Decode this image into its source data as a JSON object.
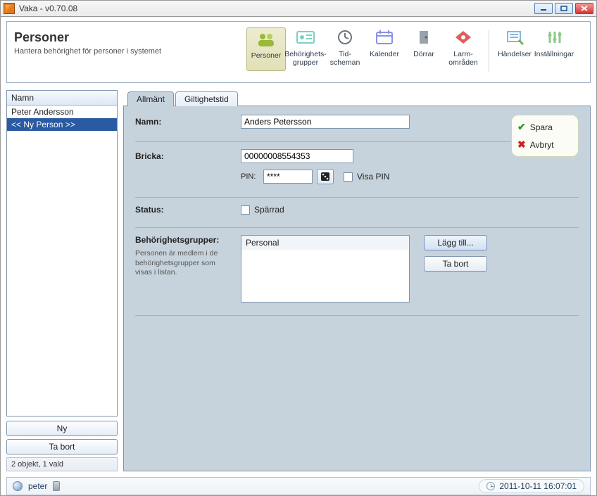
{
  "window": {
    "title": "Vaka - v0.70.08"
  },
  "header": {
    "title": "Personer",
    "subtitle": "Hantera behörighet för personer i systemet"
  },
  "toolbar": {
    "items": [
      {
        "label": "Personer",
        "selected": true
      },
      {
        "label": "Behörighets-\ngrupper"
      },
      {
        "label": "Tid-\nscheman"
      },
      {
        "label": "Kalender"
      },
      {
        "label": "Dörrar"
      },
      {
        "label": "Larm-\nområden"
      }
    ],
    "right_items": [
      {
        "label": "Händelser"
      },
      {
        "label": "Inställningar"
      }
    ]
  },
  "sidebar": {
    "header": "Namn",
    "items": [
      {
        "label": "Peter Andersson",
        "selected": false
      },
      {
        "label": "<< Ny Person >>",
        "selected": true
      }
    ],
    "buttons": {
      "new": "Ny",
      "delete": "Ta bort"
    },
    "status": "2 objekt, 1 vald"
  },
  "tabs": {
    "items": [
      {
        "label": "Allmänt",
        "active": true
      },
      {
        "label": "Giltighetstid",
        "active": false
      }
    ]
  },
  "form": {
    "name_label": "Namn:",
    "name_value": "Anders Petersson",
    "bricka_label": "Bricka:",
    "bricka_value": "00000008554353",
    "pin_label": "PIN:",
    "pin_value": "****",
    "visa_pin_label": "Visa PIN",
    "status_label": "Status:",
    "sparrad_label": "Spärrad",
    "groups_label": "Behörighetsgrupper:",
    "groups_help": "Personen är medlem i de behörighetsgrupper som visas i listan.",
    "groups": [
      "Personal"
    ],
    "add_btn": "Lägg till...",
    "remove_btn": "Ta bort"
  },
  "actions": {
    "save": "Spara",
    "cancel": "Avbryt"
  },
  "footer": {
    "user": "peter",
    "datetime": "2011-10-11 16:07:01"
  }
}
